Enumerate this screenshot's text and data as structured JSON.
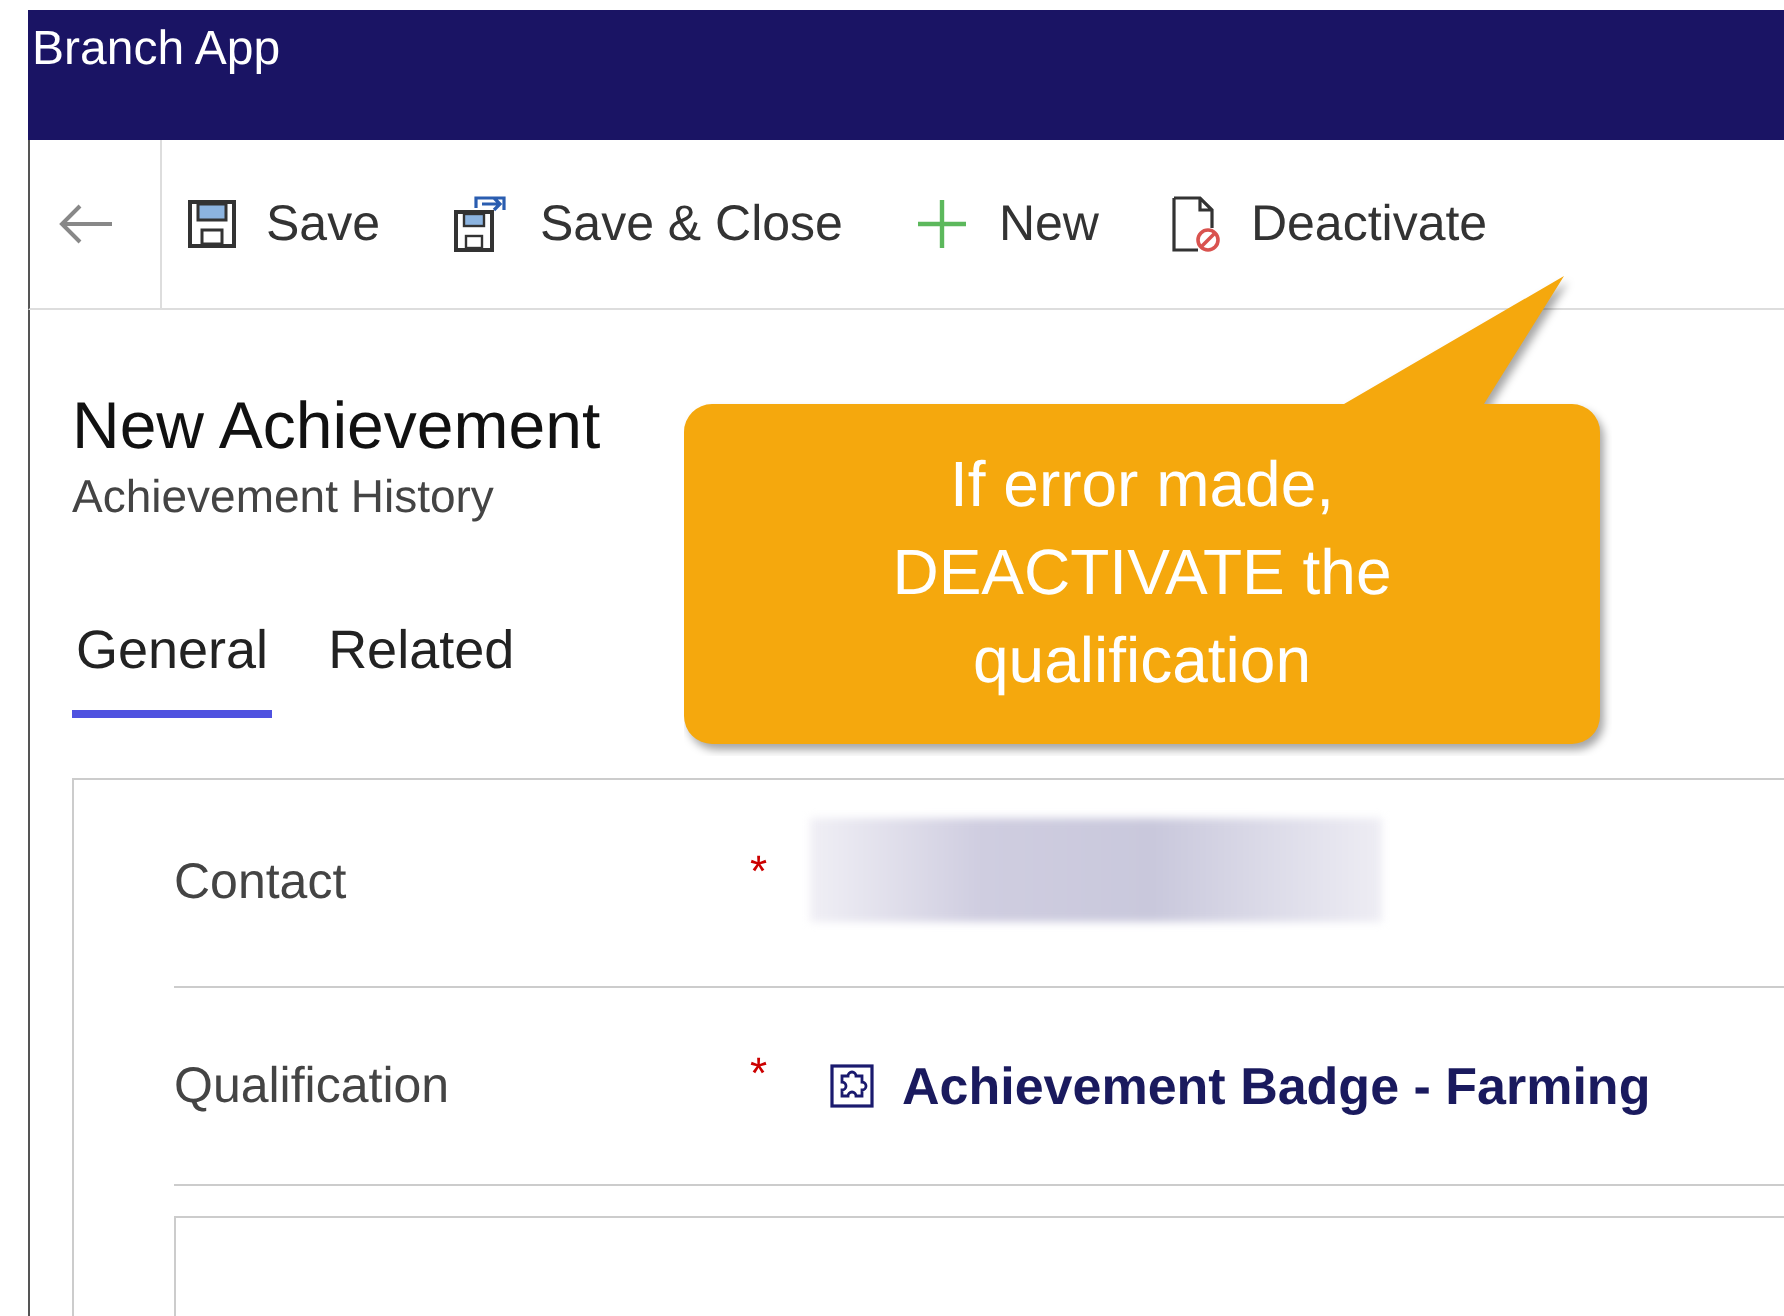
{
  "app_bar": {
    "title": "Branch App"
  },
  "commands": [
    {
      "kind": "back"
    },
    {
      "kind": "save",
      "label": "Save"
    },
    {
      "kind": "save_close",
      "label": "Save & Close"
    },
    {
      "kind": "new",
      "label": "New"
    },
    {
      "kind": "deactivate",
      "label": "Deactivate"
    }
  ],
  "header": {
    "title": "New Achievement",
    "subtitle": "Achievement History"
  },
  "tabs": [
    {
      "label": "General",
      "selected": true
    },
    {
      "label": "Related",
      "selected": false
    }
  ],
  "fields": [
    {
      "label": "Contact",
      "required": true,
      "required_mark": "*",
      "kind": "redacted"
    },
    {
      "label": "Qualification",
      "required": true,
      "required_mark": "*",
      "kind": "lookup",
      "value": "Achievement Badge - Farming"
    }
  ],
  "callout": {
    "lines": [
      "If error made,",
      "DEACTIVATE the",
      "qualification"
    ]
  }
}
